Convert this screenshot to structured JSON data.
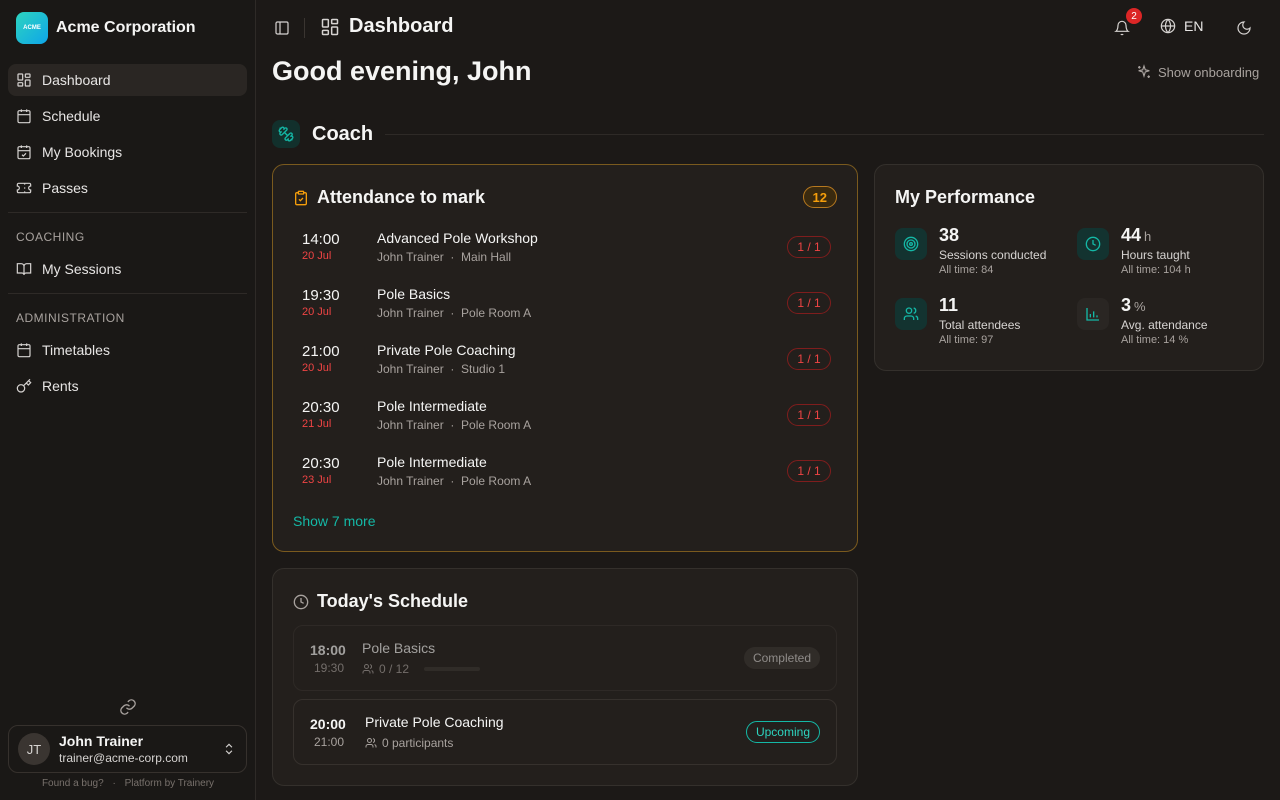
{
  "sidebar": {
    "brand": {
      "logo_text": "ACME",
      "name": "Acme Corporation"
    },
    "main_items": [
      {
        "label": "Dashboard",
        "icon": "grid-icon",
        "active": true
      },
      {
        "label": "Schedule",
        "icon": "calendar-icon"
      },
      {
        "label": "My Bookings",
        "icon": "calendar-check-icon"
      },
      {
        "label": "Passes",
        "icon": "ticket-icon"
      }
    ],
    "coaching_label": "COACHING",
    "coaching_items": [
      {
        "label": "My Sessions",
        "icon": "book-open-icon"
      }
    ],
    "admin_label": "ADMINISTRATION",
    "admin_items": [
      {
        "label": "Timetables",
        "icon": "calendar-days-icon"
      },
      {
        "label": "Rents",
        "icon": "key-icon"
      }
    ],
    "user": {
      "initials": "JT",
      "name": "John Trainer",
      "email": "trainer@acme-corp.com"
    },
    "footer": {
      "bug": "Found a bug?",
      "sep": "·",
      "platform": "Platform by Trainery"
    }
  },
  "topbar": {
    "title": "Dashboard",
    "notifications": "2",
    "language": "EN"
  },
  "greeting": "Good evening, John",
  "onboarding_label": "Show onboarding",
  "coach_section": "Coach",
  "attendance": {
    "title": "Attendance to mark",
    "count": "12",
    "rows": [
      {
        "time": "14:00",
        "date": "20 Jul",
        "name": "Advanced Pole Workshop",
        "trainer": "John Trainer",
        "room": "Main Hall",
        "ratio": "1 / 1"
      },
      {
        "time": "19:30",
        "date": "20 Jul",
        "name": "Pole Basics",
        "trainer": "John Trainer",
        "room": "Pole Room A",
        "ratio": "1 / 1"
      },
      {
        "time": "21:00",
        "date": "20 Jul",
        "name": "Private Pole Coaching",
        "trainer": "John Trainer",
        "room": "Studio 1",
        "ratio": "1 / 1"
      },
      {
        "time": "20:30",
        "date": "21 Jul",
        "name": "Pole Intermediate",
        "trainer": "John Trainer",
        "room": "Pole Room A",
        "ratio": "1 / 1"
      },
      {
        "time": "20:30",
        "date": "23 Jul",
        "name": "Pole Intermediate",
        "trainer": "John Trainer",
        "room": "Pole Room A",
        "ratio": "1 / 1"
      }
    ],
    "show_more": "Show 7 more"
  },
  "performance": {
    "title": "My Performance",
    "stats": [
      {
        "value": "38",
        "unit": "",
        "label": "Sessions conducted",
        "sub": "All time: 84",
        "icon": "target-icon"
      },
      {
        "value": "44",
        "unit": "h",
        "label": "Hours taught",
        "sub": "All time: 104 h",
        "icon": "clock-icon"
      },
      {
        "value": "11",
        "unit": "",
        "label": "Total attendees",
        "sub": "All time: 97",
        "icon": "users-icon"
      },
      {
        "value": "3",
        "unit": "%",
        "label": "Avg. attendance",
        "sub": "All time: 14 %",
        "icon": "bar-chart-icon"
      }
    ]
  },
  "schedule": {
    "title": "Today's Schedule",
    "sessions": [
      {
        "start": "18:00",
        "end": "19:30",
        "name": "Pole Basics",
        "meta": "0 / 12",
        "status": "Completed",
        "fill": 0
      },
      {
        "start": "20:00",
        "end": "21:00",
        "name": "Private Pole Coaching",
        "meta": "0 participants",
        "status": "Upcoming"
      }
    ]
  },
  "colors": {
    "accent": "#14b8a6",
    "warning": "#f59e0b",
    "danger": "#ef4444",
    "background": "#1c1917"
  }
}
